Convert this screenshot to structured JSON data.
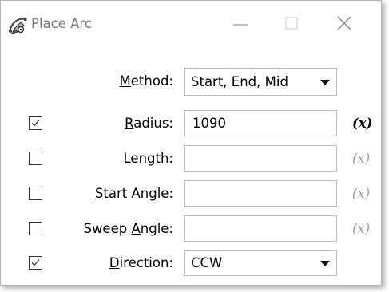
{
  "window": {
    "title": "Place Arc",
    "app_icon": "place-arc-tool-icon"
  },
  "titlebar_buttons": {
    "minimize": "minimize-icon",
    "maximize": "maximize-icon",
    "close": "close-icon"
  },
  "method": {
    "label_underlined": "M",
    "label_rest": "ethod:",
    "value": "Start, End, Mid"
  },
  "radius": {
    "checked": true,
    "label_underlined": "R",
    "label_rest": "adius:",
    "value": "1090",
    "variable_button": "(x)",
    "variable_active": true
  },
  "length": {
    "checked": false,
    "label_underlined": "L",
    "label_rest": "ength:",
    "value": "",
    "variable_button": "(x)",
    "variable_active": false
  },
  "start_angle": {
    "checked": false,
    "label_underlined": "S",
    "label_rest": "tart Angle:",
    "value": "",
    "variable_button": "(x)",
    "variable_active": false
  },
  "sweep_angle": {
    "checked": false,
    "label_prefix": "Sweep ",
    "label_underlined": "A",
    "label_rest": "ngle:",
    "value": "",
    "variable_button": "(x)",
    "variable_active": false
  },
  "direction": {
    "checked": true,
    "label_underlined": "D",
    "label_rest": "irection:",
    "value": "CCW"
  },
  "colors": {
    "border": "#bfbfbf",
    "text": "#000000",
    "disabled_text": "#a0a0a0",
    "title_text": "#7a7a7a"
  }
}
